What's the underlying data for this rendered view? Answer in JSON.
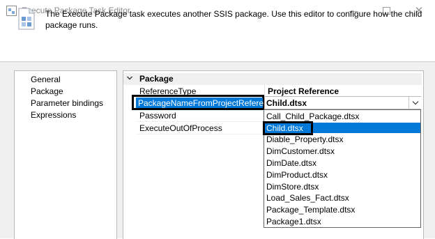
{
  "window": {
    "title": "Execute Package Task Editor",
    "minimize": "—",
    "close": "✕"
  },
  "header": {
    "description": "The Execute Package task executes another SSIS package. Use this editor to configure how the child package runs."
  },
  "nav": {
    "items": [
      "General",
      "Package",
      "Parameter bindings",
      "Expressions"
    ]
  },
  "grid": {
    "category": "Package",
    "properties": [
      {
        "name": "ReferenceType",
        "value": "Project Reference"
      },
      {
        "name": "PackageNameFromProjectReference",
        "value": "Child.dtsx"
      },
      {
        "name": "Password",
        "value": ""
      },
      {
        "name": "ExecuteOutOfProcess",
        "value": ""
      }
    ]
  },
  "dropdown": {
    "selected": "Child.dtsx",
    "options": [
      "Call_Child_Package.dtsx",
      "Child.dtsx",
      "Diable_Property.dtsx",
      "DimCustomer.dtsx",
      "DimDate.dtsx",
      "DimProduct.dtsx",
      "DimStore.dtsx",
      "Load_Sales_Fact.dtsx",
      "Package_Template.dtsx",
      "Package1.dtsx"
    ]
  },
  "colors": {
    "selection": "#0078d7",
    "panel_bg": "#f0f0f0",
    "highlight_border": "#000000"
  }
}
